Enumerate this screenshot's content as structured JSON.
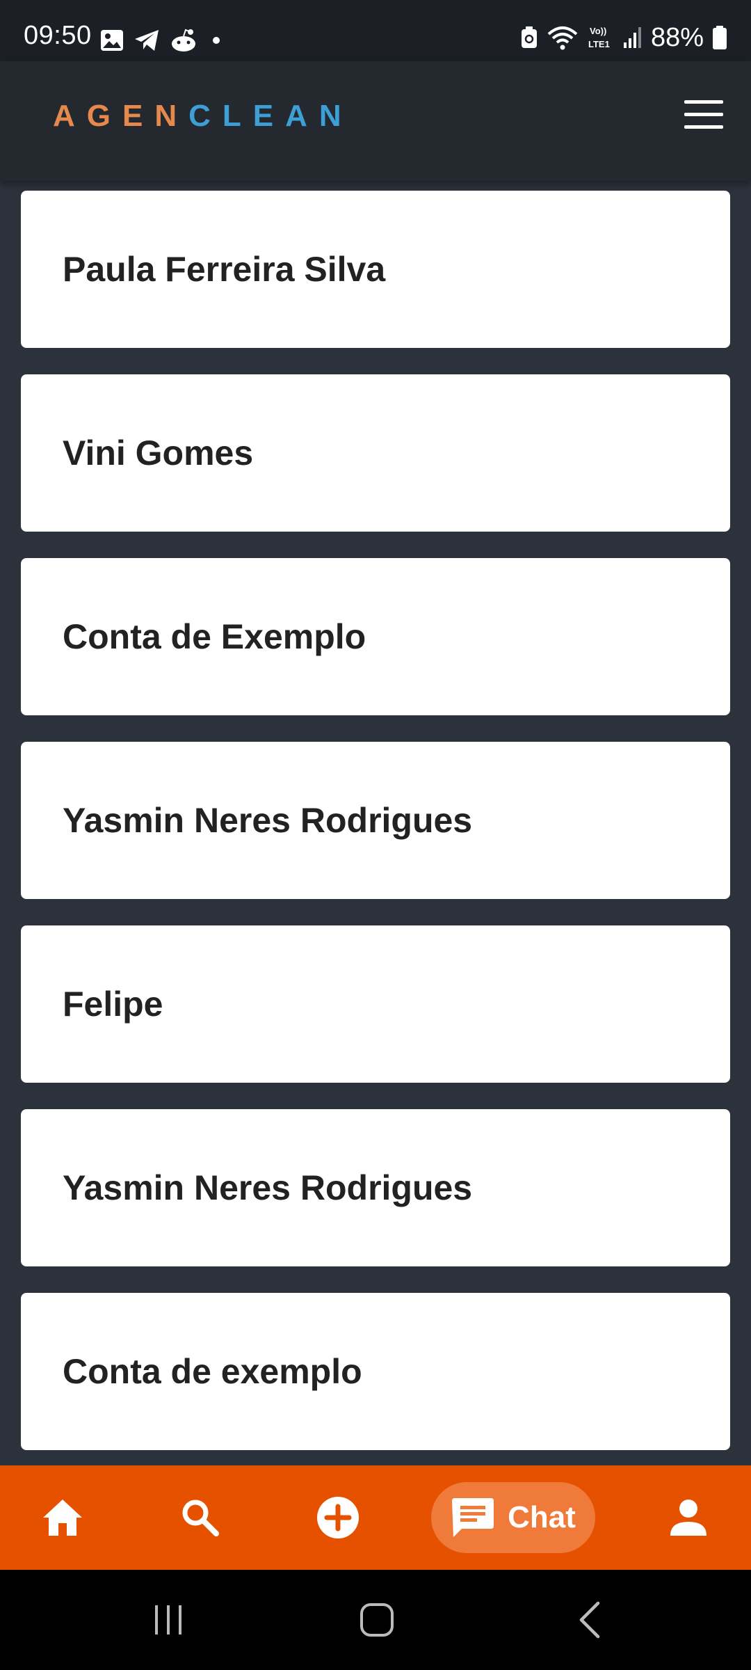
{
  "status_bar": {
    "time": "09:50",
    "battery": "88%",
    "notification_icons": [
      "image-icon",
      "telegram-icon",
      "reddit-icon",
      "dot-icon"
    ],
    "system_icons": [
      "battery-saver-icon",
      "wifi-icon",
      "volte-icon",
      "signal-icon",
      "battery-icon"
    ]
  },
  "header": {
    "logo_part1": "AGEN",
    "logo_part2": "CLEAN",
    "menu_icon": "hamburger-menu-icon"
  },
  "contacts": [
    {
      "name": "Paula Ferreira Silva"
    },
    {
      "name": "Vini Gomes"
    },
    {
      "name": "Conta de Exemplo"
    },
    {
      "name": "Yasmin Neres Rodrigues"
    },
    {
      "name": "Felipe"
    },
    {
      "name": "Yasmin Neres Rodrigues"
    },
    {
      "name": "Conta de exemplo"
    }
  ],
  "bottom_nav": {
    "items": [
      {
        "icon": "home-icon"
      },
      {
        "icon": "search-icon"
      },
      {
        "icon": "add-circle-icon"
      },
      {
        "icon": "chat-icon",
        "label": "Chat",
        "active": true
      },
      {
        "icon": "person-icon"
      }
    ]
  },
  "colors": {
    "accent": "#e65100",
    "active_pill": "#f07a3a",
    "background": "#2c323b",
    "header": "#24282f",
    "logo_orange": "#e6894d",
    "logo_blue": "#3e9ed6"
  }
}
